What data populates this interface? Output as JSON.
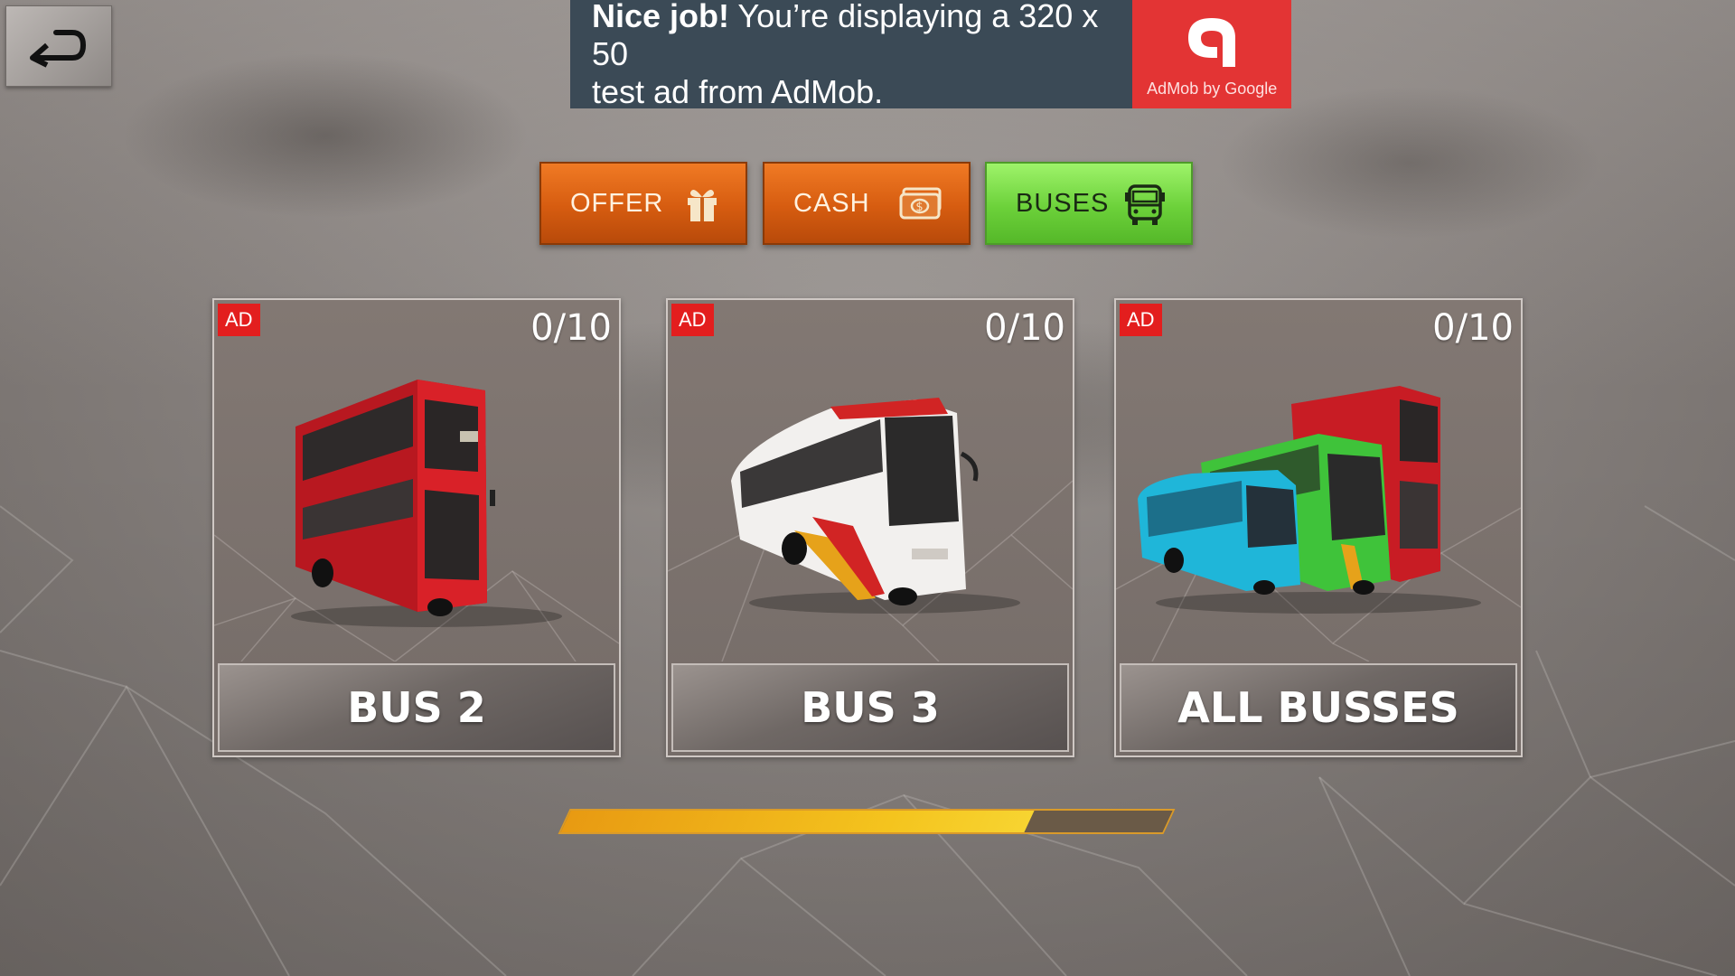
{
  "ad_banner": {
    "headline": "Nice job!",
    "line1": " You’re displaying a 320 x 50",
    "line2": "test ad from AdMob.",
    "logo_caption": "AdMob by Google"
  },
  "back_button": {
    "icon": "back-arrow-icon"
  },
  "tabs": [
    {
      "label": "OFFER",
      "icon": "gift-icon",
      "color": "#e06a18",
      "selected": false
    },
    {
      "label": "CASH",
      "icon": "cash-icon",
      "color": "#e06a18",
      "selected": false
    },
    {
      "label": "BUSES",
      "icon": "bus-icon",
      "color": "#7bd94a",
      "selected": true
    }
  ],
  "cards": [
    {
      "badge": "AD",
      "count": "0/10",
      "label": "BUS 2",
      "image": "red double-decker bus"
    },
    {
      "badge": "AD",
      "count": "0/10",
      "label": "BUS 3",
      "image": "white coach bus"
    },
    {
      "badge": "AD",
      "count": "0/10",
      "label": "ALL BUSSES",
      "image": "blue, green and red buses"
    }
  ],
  "progress": {
    "value": 0.77
  }
}
